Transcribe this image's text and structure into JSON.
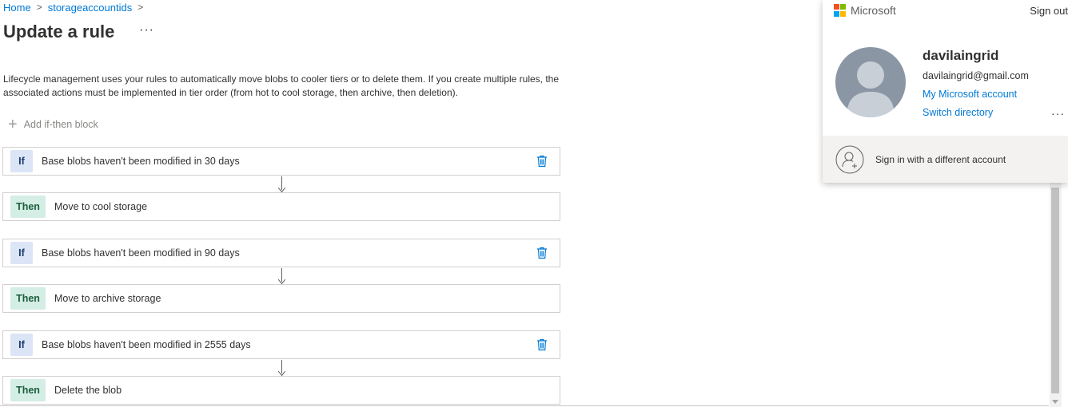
{
  "breadcrumb": {
    "home": "Home",
    "account": "storageaccountids",
    "sep": ">"
  },
  "page": {
    "title": "Update a rule",
    "more": "···"
  },
  "description": "Lifecycle management uses your rules to automatically move blobs to cooler tiers or to delete them. If you create multiple rules, the associated actions must be implemented in tier order (from hot to cool storage, then archive, then deletion).",
  "add_block": {
    "icon": "plus-icon",
    "label": "Add if-then block"
  },
  "rules": [
    {
      "if_tag": "If",
      "condition": "Base blobs haven't been modified in 30 days",
      "then_tag": "Then",
      "action": "Move to cool storage"
    },
    {
      "if_tag": "If",
      "condition": "Base blobs haven't been modified in 90 days",
      "then_tag": "Then",
      "action": "Move to archive storage"
    },
    {
      "if_tag": "If",
      "condition": "Base blobs haven't been modified in 2555 days",
      "then_tag": "Then",
      "action": "Delete the blob"
    }
  ],
  "account_panel": {
    "brand": "Microsoft",
    "sign_out": "Sign out",
    "user_name": "davilaingrid",
    "email": "davilaingrid@gmail.com",
    "my_account_link": "My Microsoft account",
    "switch_directory_link": "Switch directory",
    "more": "···",
    "switch_account_label": "Sign in with a different account"
  },
  "colors": {
    "accent": "#0078d4",
    "if_tag_bg": "#dbe5f6",
    "then_tag_bg": "#d4ede5"
  }
}
